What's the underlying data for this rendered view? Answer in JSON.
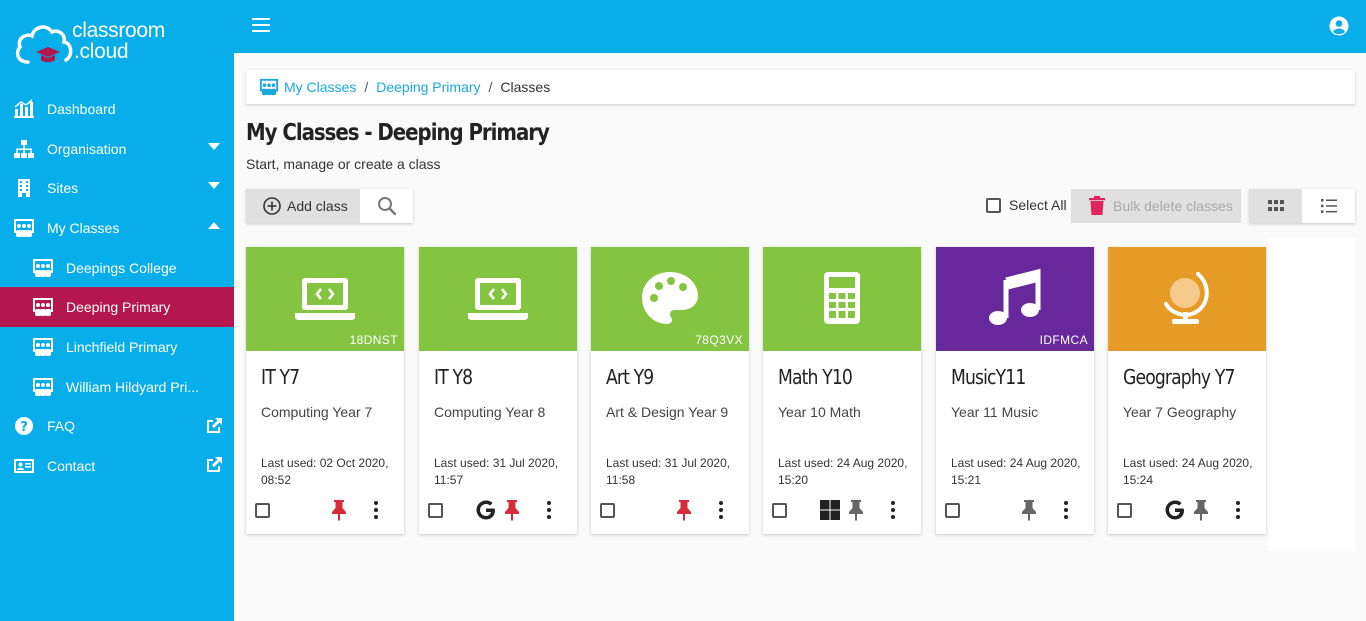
{
  "app": {
    "logo_line1": "classroom",
    "logo_line2": ".cloud"
  },
  "colors": {
    "sidebar": "#08aee9",
    "active": "#b3174d",
    "green": "#84c441",
    "purple": "#67289b",
    "orange": "#e59b26",
    "pin_red": "#d72a3b",
    "pin_grey": "#666666"
  },
  "sidebar": {
    "items": [
      {
        "label": "Dashboard",
        "icon": "chart-icon"
      },
      {
        "label": "Organisation",
        "icon": "sitemap-icon"
      },
      {
        "label": "Sites",
        "icon": "building-icon"
      },
      {
        "label": "My Classes",
        "icon": "classes-icon"
      },
      {
        "label": "Deepings College",
        "icon": "classes-icon"
      },
      {
        "label": "Deeping Primary",
        "icon": "classes-icon"
      },
      {
        "label": "Linchfield Primary",
        "icon": "classes-icon"
      },
      {
        "label": "William Hildyard Pri...",
        "icon": "classes-icon"
      },
      {
        "label": "FAQ",
        "icon": "question-icon"
      },
      {
        "label": "Contact",
        "icon": "contact-card-icon"
      }
    ]
  },
  "breadcrumb": {
    "item1": "My Classes",
    "sep": "/",
    "item2": "Deeping Primary",
    "current": "Classes"
  },
  "page": {
    "title": "My Classes - Deeping Primary",
    "subtitle": "Start, manage or create a class"
  },
  "toolbar": {
    "add_label": "Add class",
    "select_all": "Select All",
    "bulk_delete": "Bulk delete classes"
  },
  "cards": [
    {
      "title": "IT Y7",
      "desc": "Computing Year 7",
      "code": "18DNST",
      "used_line1": "Last used: 02 Oct 2020,",
      "used_line2": "08:52",
      "icon": "laptop-code-icon",
      "pin": "red",
      "provider": ""
    },
    {
      "title": "IT Y8",
      "desc": "Computing Year 8",
      "code": "",
      "used_line1": "Last used: 31 Jul 2020,",
      "used_line2": "11:57",
      "icon": "laptop-code-icon",
      "pin": "red",
      "provider": "google"
    },
    {
      "title": "Art Y9",
      "desc": "Art & Design Year 9",
      "code": "78Q3VX",
      "used_line1": "Last used: 31 Jul 2020,",
      "used_line2": "11:58",
      "icon": "palette-icon",
      "pin": "red",
      "provider": ""
    },
    {
      "title": "Math Y10",
      "desc": "Year 10 Math",
      "code": "",
      "used_line1": "Last used: 24 Aug 2020,",
      "used_line2": "15:20",
      "icon": "calculator-icon",
      "pin": "grey",
      "provider": "microsoft"
    },
    {
      "title": "MusicY11",
      "desc": "Year 11 Music",
      "code": "IDFMCA",
      "used_line1": "Last used: 24 Aug 2020,",
      "used_line2": "15:21",
      "icon": "music-note-icon",
      "pin": "grey",
      "provider": ""
    },
    {
      "title": "Geography Y7",
      "desc": "Year 7 Geography",
      "code": "",
      "used_line1": "Last used: 24 Aug 2020,",
      "used_line2": "15:24",
      "icon": "globe-icon",
      "pin": "grey",
      "provider": "google"
    }
  ]
}
